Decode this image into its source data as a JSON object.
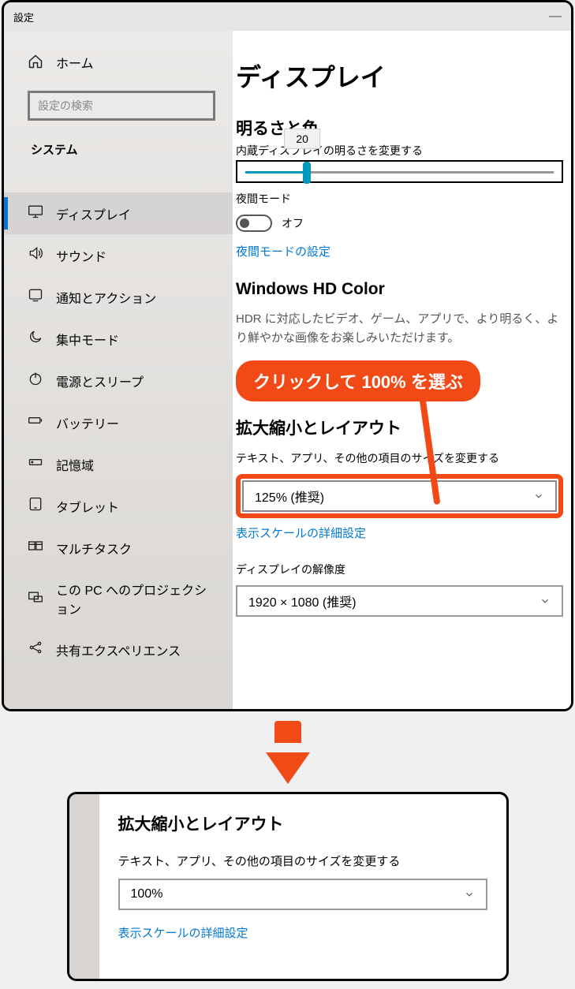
{
  "titlebar": {
    "title": "設定"
  },
  "sidebar": {
    "home": "ホーム",
    "search_placeholder": "設定の検索",
    "category": "システム",
    "items": [
      {
        "label": "ディスプレイ",
        "icon": "monitor",
        "active": true
      },
      {
        "label": "サウンド",
        "icon": "sound"
      },
      {
        "label": "通知とアクション",
        "icon": "notify"
      },
      {
        "label": "集中モード",
        "icon": "moon"
      },
      {
        "label": "電源とスリープ",
        "icon": "power"
      },
      {
        "label": "バッテリー",
        "icon": "battery"
      },
      {
        "label": "記憶域",
        "icon": "storage"
      },
      {
        "label": "タブレット",
        "icon": "tablet"
      },
      {
        "label": "マルチタスク",
        "icon": "multitask"
      },
      {
        "label": "この PC へのプロジェクション",
        "icon": "project"
      },
      {
        "label": "共有エクスペリエンス",
        "icon": "share"
      }
    ]
  },
  "page": {
    "title": "ディスプレイ",
    "sect_brightness": "明るさと色",
    "brightness_label": "内蔵ディスプレイの明るさを変更する",
    "brightness_value": "20",
    "night_label": "夜間モード",
    "night_state": "オフ",
    "night_link": "夜間モードの設定",
    "sect_hdr": "Windows HD Color",
    "hdr_desc": "HDR に対応したビデオ、ゲーム、アプリで、より明るく、より鮮やかな画像をお楽しみいただけます。",
    "callout": "クリックして 100% を選ぶ",
    "sect_scale": "拡大縮小とレイアウト",
    "scale_label": "テキスト、アプリ、その他の項目のサイズを変更する",
    "scale_value": "125% (推奨)",
    "scale_link": "表示スケールの詳細設定",
    "res_label": "ディスプレイの解像度",
    "res_value": "1920 × 1080 (推奨)"
  },
  "panel2": {
    "sect": "拡大縮小とレイアウト",
    "label": "テキスト、アプリ、その他の項目のサイズを変更する",
    "value": "100%",
    "link": "表示スケールの詳細設定"
  }
}
